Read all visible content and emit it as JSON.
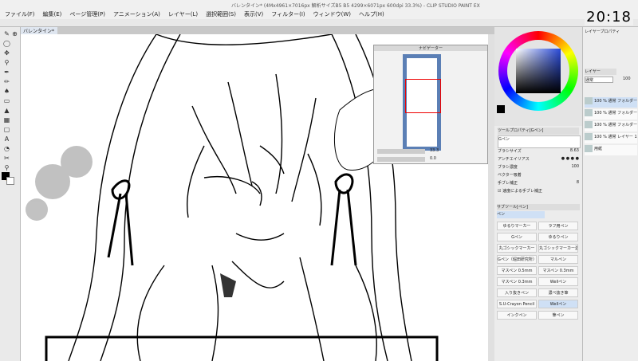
{
  "window": {
    "title": "バレンタイン* (4Mx4961×7016px 解析サイズB5 B5 4299×6071px 600dpi 33.3%) - CLIP STUDIO PAINT EX"
  },
  "menu": [
    "ファイル(F)",
    "編集(E)",
    "ページ管理(P)",
    "アニメーション(A)",
    "レイヤー(L)",
    "選択範囲(S)",
    "表示(V)",
    "フィルター(I)",
    "ウィンドウ(W)",
    "ヘルプ(H)"
  ],
  "clock": "20:18",
  "document_tab": "バレンタイン*",
  "status": {
    "zoom": "33.3"
  },
  "navigator": {
    "title": "ナビゲーター",
    "zoom": "33.3",
    "angle": "0.0"
  },
  "color_panel": {
    "title": "カラーサークル",
    "accent": "#2a4bd9"
  },
  "tool_property": {
    "header": "ツールプロパティ[Gペン]",
    "tool_name": "Gペン",
    "brush_size_label": "ブラシサイズ",
    "brush_size_value": "8.63",
    "anti_alias_label": "アンチエイリアス",
    "density_label": "ブラシ濃度",
    "density_value": "100",
    "vector_label": "ベクター吸着",
    "correction_label": "手ブレ補正",
    "correction_value": "8",
    "speed_label": "速度による手ブレ補正"
  },
  "subtool": {
    "header": "サブツール[ペン]",
    "group": "ペン",
    "items": [
      "ゆるりマーカー",
      "ラフ用ペン",
      "Gペン",
      "ゆるりペン",
      "丸ゴシックマーカー",
      "丸ゴシックマーカー濃",
      "Gペン（堀田研究所）",
      "マルペン",
      "マスペン 0.5mm",
      "マスペン 0.3mm",
      "マスペン 0.3mm",
      "Wellペン",
      "入り抜きペン",
      "濃べ抜き筆",
      "S.U-Crayon Pencil",
      "Wellペン",
      "インクペン",
      "筆ペン"
    ]
  },
  "layer_panel": {
    "title": "レイヤープロパティ",
    "tab": "レイヤー",
    "blend_mode": "通常",
    "opacity": "100",
    "layers": [
      {
        "name": "100 % 通常 フォルダー 3"
      },
      {
        "name": "100 % 通常 フォルダー 2"
      },
      {
        "name": "100 % 通常 フォルダー 1"
      },
      {
        "name": "100 % 通常 レイヤー 1"
      },
      {
        "name": "用紙"
      }
    ]
  }
}
